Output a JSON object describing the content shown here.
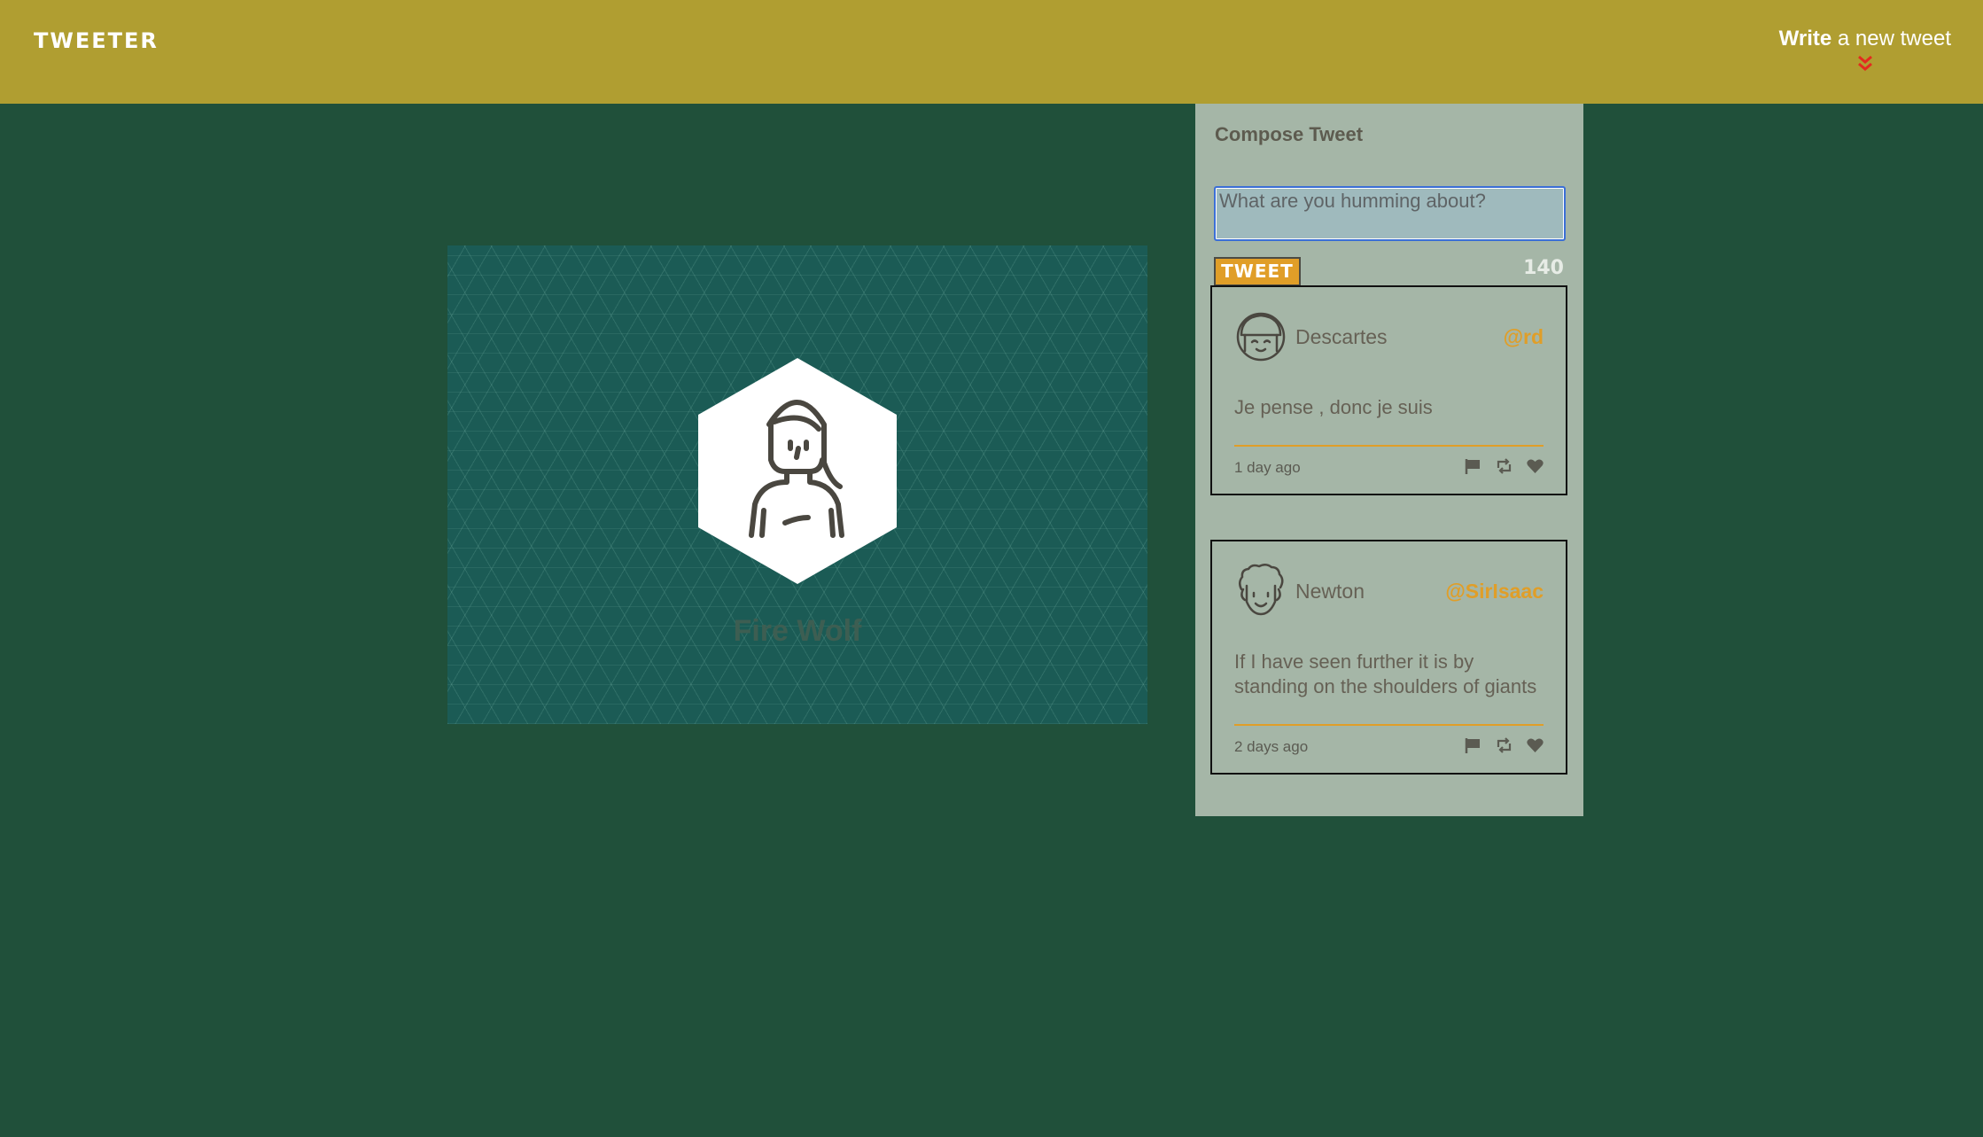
{
  "nav": {
    "logo": "TWEETER",
    "compose_toggle_bold": "Write",
    "compose_toggle_rest": " a new tweet"
  },
  "profile": {
    "name": "Fire Wolf"
  },
  "compose": {
    "title": "Compose Tweet",
    "placeholder": "What are you humming about?",
    "button_label": "TWEET",
    "counter": "140"
  },
  "tweets": [
    {
      "name": "Descartes",
      "handle": "@rd",
      "text": "Je pense , donc je suis",
      "time": "1 day ago"
    },
    {
      "name": "Newton",
      "handle": "@SirIsaac",
      "text": "If I have seen further it is by standing on the shoulders of giants",
      "time": "2 days ago"
    }
  ],
  "icons": {
    "flag": "flag-icon",
    "retweet": "retweet-icon",
    "like": "heart-icon"
  },
  "colors": {
    "nav": "#b09e31",
    "background": "#20503a",
    "sidebar": "#a5b6a7",
    "accent": "#e09e28",
    "chevron": "#e32b1e"
  }
}
